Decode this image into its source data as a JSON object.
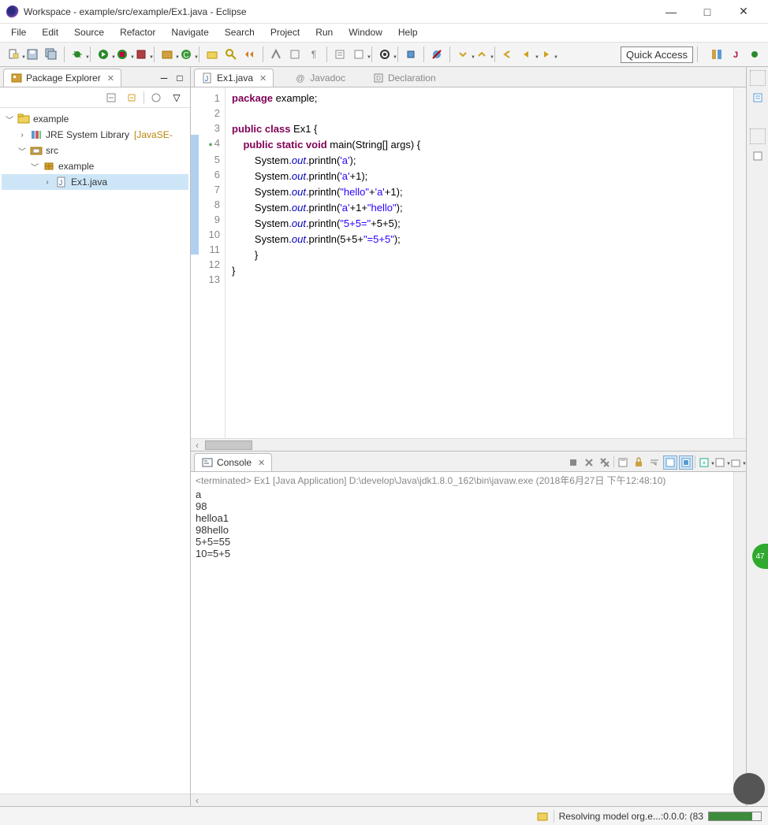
{
  "window": {
    "title": "Workspace - example/src/example/Ex1.java - Eclipse",
    "min": "—",
    "max": "□",
    "close": "✕"
  },
  "menu": [
    "File",
    "Edit",
    "Source",
    "Refactor",
    "Navigate",
    "Search",
    "Project",
    "Run",
    "Window",
    "Help"
  ],
  "quick_access": "Quick Access",
  "package_explorer": {
    "title": "Package Explorer",
    "tree": {
      "root": "example",
      "lib": "JRE System Library",
      "lib_qual": "[JavaSE-",
      "src": "src",
      "pkg": "example",
      "file": "Ex1.java"
    }
  },
  "editor": {
    "tabs": {
      "active": "Ex1.java",
      "javadoc": "Javadoc",
      "decl": "Declaration"
    },
    "line_numbers": [
      "1",
      "2",
      "3",
      "4",
      "5",
      "6",
      "7",
      "8",
      "9",
      "10",
      "11",
      "12",
      "13"
    ],
    "code": {
      "l1_a": "package",
      "l1_b": " example;",
      "l3_a": "public class",
      "l3_b": " Ex1 {",
      "l4_a": "    public static void",
      "l4_b": " main(String[] args) {",
      "l5_a": "        System.",
      "l5_out": "out",
      "l5_b": ".println(",
      "l5_s": "'a'",
      "l5_c": ");",
      "l6_a": "        System.",
      "l6_b": ".println(",
      "l6_s": "'a'",
      "l6_c": "+1);",
      "l7_a": "        System.",
      "l7_b": ".println(",
      "l7_s": "\"hello\"",
      "l7_c": "+",
      "l7_s2": "'a'",
      "l7_d": "+1);",
      "l8_a": "        System.",
      "l8_b": ".println(",
      "l8_s": "'a'",
      "l8_c": "+1+",
      "l8_s2": "\"hello\"",
      "l8_d": ");",
      "l9_a": "        System.",
      "l9_b": ".println(",
      "l9_s": "\"5+5=\"",
      "l9_c": "+5+5);",
      "l10_a": "        System.",
      "l10_b": ".println(5+5+",
      "l10_s": "\"=5+5\"",
      "l10_c": ");",
      "l11": "        }",
      "l12": "}",
      "l13": ""
    }
  },
  "console": {
    "title": "Console",
    "terminated": "<terminated> Ex1 [Java Application] D:\\develop\\Java\\jdk1.8.0_162\\bin\\javaw.exe (2018年6月27日 下午12:48:10)",
    "output": [
      "a",
      "98",
      "helloa1",
      "98hello",
      "5+5=55",
      "10=5+5"
    ]
  },
  "status": {
    "resolving": "Resolving model org.e...:0.0.0: (83",
    "progress_pct": 83
  },
  "bubble": "47"
}
